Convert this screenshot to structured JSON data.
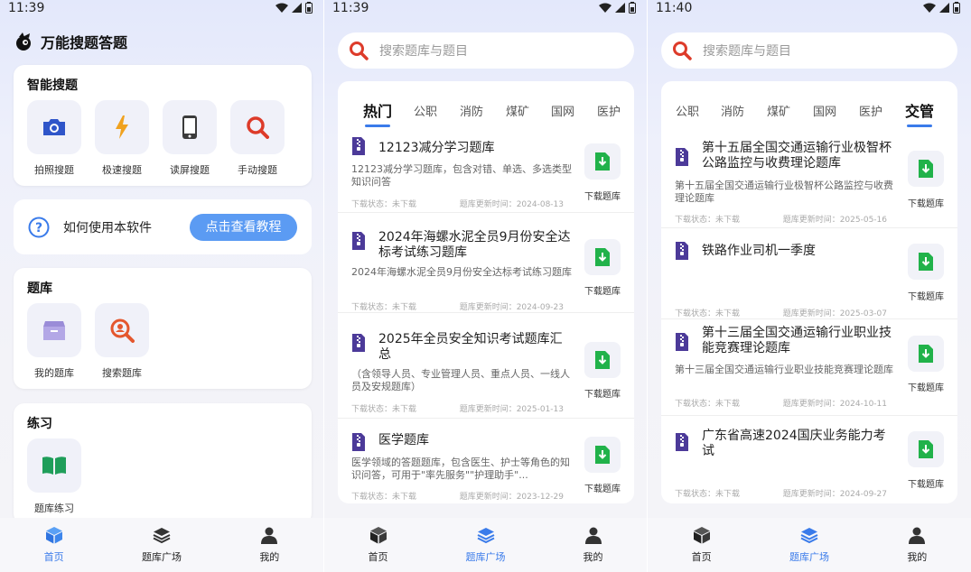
{
  "colors": {
    "accent": "#3a7bea",
    "download_green": "#21b24a",
    "book_purple": "#4c3a99"
  },
  "screens": [
    {
      "time": "11:39",
      "app_title": "万能搜题答题",
      "smart_search": {
        "title": "智能搜题",
        "tools": [
          {
            "label": "拍照搜题",
            "icon": "camera-icon"
          },
          {
            "label": "极速搜题",
            "icon": "lightning-icon"
          },
          {
            "label": "读屏搜题",
            "icon": "phone-screen-icon"
          },
          {
            "label": "手动搜题",
            "icon": "magnifier-icon"
          }
        ]
      },
      "help": {
        "text": "如何使用本软件",
        "button": "点击查看教程"
      },
      "bank": {
        "title": "题库",
        "tools": [
          {
            "label": "我的题库",
            "icon": "box-icon"
          },
          {
            "label": "搜索题库",
            "icon": "search-bank-icon"
          }
        ]
      },
      "practice": {
        "title": "练习",
        "tools": [
          {
            "label": "题库练习",
            "icon": "book-icon"
          }
        ]
      },
      "nav": [
        {
          "label": "首页",
          "active": true
        },
        {
          "label": "题库广场",
          "active": false
        },
        {
          "label": "我的",
          "active": false
        }
      ]
    },
    {
      "time": "11:39",
      "search_placeholder": "搜索题库与题目",
      "tabs": [
        {
          "label": "热门",
          "active": true
        },
        {
          "label": "公职",
          "active": false
        },
        {
          "label": "消防",
          "active": false
        },
        {
          "label": "煤矿",
          "active": false
        },
        {
          "label": "国网",
          "active": false
        },
        {
          "label": "医护",
          "active": false
        }
      ],
      "items": [
        {
          "title": "12123减分学习题库",
          "desc": "12123减分学习题库，包含对错、单选、多选类型知识问答",
          "status": "下载状态：未下载",
          "updated": "题库更新时间：2024-08-13",
          "download": "下载题库"
        },
        {
          "title": "2024年海螺水泥全员9月份安全达标考试练习题库",
          "desc": "2024年海螺水泥全员9月份安全达标考试练习题库",
          "status": "下载状态：未下载",
          "updated": "题库更新时间：2024-09-23",
          "download": "下载题库"
        },
        {
          "title": "2025年全员安全知识考试题库汇总",
          "desc": "（含领导人员、专业管理人员、重点人员、一线人员及安规题库）",
          "status": "下载状态：未下载",
          "updated": "题库更新时间：2025-01-13",
          "download": "下载题库"
        },
        {
          "title": "医学题库",
          "desc": "医学领域的答题题库，包含医生、护士等角色的知识问答，可用于\"率先服务\"\"护理助手\"...",
          "status": "下载状态：未下载",
          "updated": "题库更新时间：2023-12-29",
          "download": "下载题库"
        }
      ],
      "nav": [
        {
          "label": "首页",
          "active": false
        },
        {
          "label": "题库广场",
          "active": true
        },
        {
          "label": "我的",
          "active": false
        }
      ]
    },
    {
      "time": "11:40",
      "search_placeholder": "搜索题库与题目",
      "tabs": [
        {
          "label": "公职",
          "active": false
        },
        {
          "label": "消防",
          "active": false
        },
        {
          "label": "煤矿",
          "active": false
        },
        {
          "label": "国网",
          "active": false
        },
        {
          "label": "医护",
          "active": false
        },
        {
          "label": "交管",
          "active": true
        }
      ],
      "items": [
        {
          "title": "第十五届全国交通运输行业极智杯公路监控与收费理论题库",
          "desc": "第十五届全国交通运输行业极智杯公路监控与收费理论题库",
          "status": "下载状态：未下载",
          "updated": "题库更新时间：2025-05-16",
          "download": "下载题库"
        },
        {
          "title": "铁路作业司机一季度",
          "desc": "",
          "status": "下载状态：未下载",
          "updated": "题库更新时间：2025-03-07",
          "download": "下载题库"
        },
        {
          "title": "第十三届全国交通运输行业职业技能竞赛理论题库",
          "desc": "第十三届全国交通运输行业职业技能竞赛理论题库",
          "status": "下载状态：未下载",
          "updated": "题库更新时间：2024-10-11",
          "download": "下载题库"
        },
        {
          "title": "广东省高速2024国庆业务能力考试",
          "desc": "",
          "status": "下载状态：未下载",
          "updated": "题库更新时间：2024-09-27",
          "download": "下载题库"
        }
      ],
      "nav": [
        {
          "label": "首页",
          "active": false
        },
        {
          "label": "题库广场",
          "active": true
        },
        {
          "label": "我的",
          "active": false
        }
      ]
    }
  ]
}
